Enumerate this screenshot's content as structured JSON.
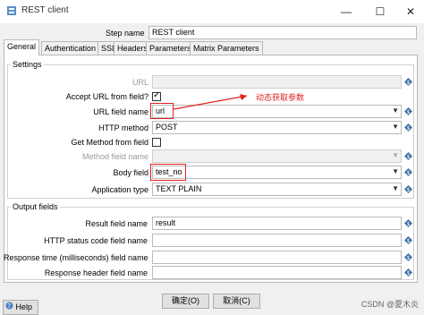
{
  "window": {
    "title": "REST client",
    "minimize_glyph": "—",
    "maximize_glyph": "☐",
    "close_glyph": "✕"
  },
  "step": {
    "label": "Step name",
    "value": "REST client"
  },
  "tabs": [
    {
      "label": "General",
      "active": true
    },
    {
      "label": "Authentication"
    },
    {
      "label": "SSL"
    },
    {
      "label": "Headers"
    },
    {
      "label": "Parameters"
    },
    {
      "label": "Matrix Parameters"
    }
  ],
  "settings": {
    "title": "Settings",
    "url": {
      "label": "URL",
      "value": ""
    },
    "accept_url": {
      "label": "Accept URL from field?",
      "checked": true
    },
    "url_field": {
      "label": "URL field name",
      "value": "url"
    },
    "http_method": {
      "label": "HTTP method",
      "value": "POST"
    },
    "get_method": {
      "label": "Get Method from field",
      "checked": false
    },
    "method_field": {
      "label": "Method field name",
      "value": ""
    },
    "body_field": {
      "label": "Body field",
      "value": "test_no"
    },
    "app_type": {
      "label": "Application type",
      "value": "TEXT PLAIN"
    }
  },
  "annotation": {
    "text": "动态获取参数",
    "color": "#e02020"
  },
  "output": {
    "title": "Output fields",
    "result": {
      "label": "Result field name",
      "value": "result"
    },
    "status": {
      "label": "HTTP status code field name",
      "value": ""
    },
    "response_time": {
      "label": "Response time (milliseconds) field name",
      "value": ""
    },
    "response_header": {
      "label": "Response header field name",
      "value": ""
    }
  },
  "buttons": {
    "ok": "确定(O)",
    "cancel": "取消(C)",
    "help": "Help"
  },
  "watermark": "CSDN @夏木炎",
  "icons": {
    "var": "variable-diamond-icon",
    "help": "help-icon",
    "app": "rest-client-icon"
  }
}
